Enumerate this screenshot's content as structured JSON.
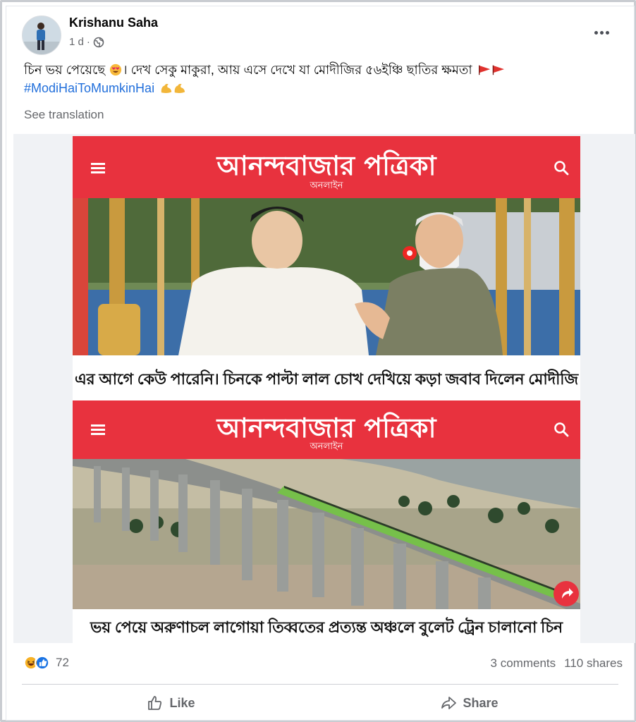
{
  "post": {
    "author": "Krishanu Saha",
    "time": "1 d",
    "separator": "·",
    "text": "চিন ভয় পেয়েছে",
    "text_2": "। দেখ সেকু মাকুরা, আয় এসে দেখে যা মোদীজির ৫৬ইঞ্চি ছাতির ক্ষমতা",
    "hashtag": "#ModiHaiToMumkinHai",
    "see_translation": "See translation"
  },
  "cards": [
    {
      "masthead_title": "আনন্দবাজার পত্রিকা",
      "masthead_sub": "অনলাইন",
      "headline": "এর আগে কেউ পারেনি। চিনকে পাল্টা লাল চোখ দেখিয়ে কড়া জবাব দিলেন মোদীজি"
    },
    {
      "masthead_title": "আনন্দবাজার পত্রিকা",
      "masthead_sub": "অনলাইন",
      "headline": "ভয় পেয়ে অরুণাচল লাগোয়া তিব্বতের প্রত্যন্ত অঞ্চলে বুলেট ট্রেন চালানো চিন"
    }
  ],
  "footer": {
    "reaction_count": "72",
    "comments": "3 comments",
    "shares": "110 shares",
    "like_label": "Like",
    "share_label": "Share"
  },
  "colors": {
    "brand_red": "#e8323e",
    "link_blue": "#216fdb",
    "muted": "#65676b"
  },
  "icons": [
    "globe-icon",
    "more-icon",
    "heart-eyes-emoji",
    "flag-emoji",
    "flexed-biceps-emoji",
    "hamburger-icon",
    "search-icon",
    "haha-reaction-icon",
    "like-reaction-icon",
    "thumbs-up-icon",
    "share-arrow-icon"
  ]
}
